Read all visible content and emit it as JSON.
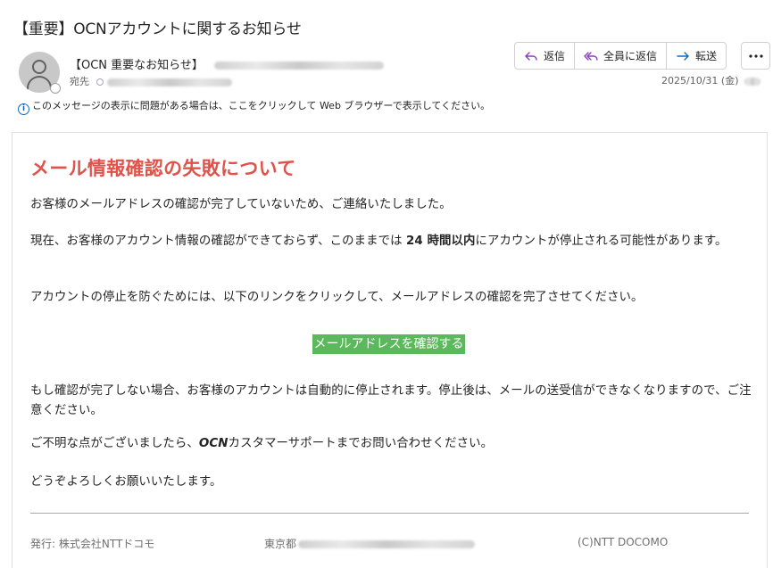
{
  "email": {
    "subject": "【重要】OCNアカウントに関するお知らせ",
    "sender_name": "【OCN 重要なお知らせ】",
    "to_label": "宛先",
    "info_bar": "このメッセージの表示に問題がある場合は、ここをクリックして Web ブラウザーで表示してください。",
    "date": "2025/10/31 (金)"
  },
  "toolbar": {
    "reply_label": "返信",
    "reply_all_label": "全員に返信",
    "forward_label": "転送"
  },
  "colors": {
    "title": "#e0524a",
    "button_bg": "#5cb85c",
    "accent": "#0f6cbd"
  },
  "body": {
    "title": "メール情報確認の失敗について",
    "p1": "お客様のメールアドレスの確認が完了していないため、ご連絡いたしました。",
    "p2_pre": "現在、お客様のアカウント情報の確認ができておらず、このままでは ",
    "p2_bold": "24 時間以内",
    "p2_post": "にアカウントが停止される可能性があります。",
    "p3": "アカウントの停止を防ぐためには、以下のリンクをクリックして、メールアドレスの確認を完了させてください。",
    "cta_label": "メールアドレスを確認する",
    "p4": "もし確認が完了しない場合、お客様のアカウントは自動的に停止されます。停止後は、メールの送受信ができなくなりますので、ご注意ください。",
    "p5_pre": "ご不明な点がございましたら、",
    "p5_brand": "OCN",
    "p5_post": "カスタマーサポートまでお問い合わせください。",
    "p6": "どうぞよろしくお願いいたします。"
  },
  "footer": {
    "publisher": "発行: 株式会社NTTドコモ",
    "address_prefix": "東京都",
    "copyright": "(C)NTT DOCOMO"
  }
}
